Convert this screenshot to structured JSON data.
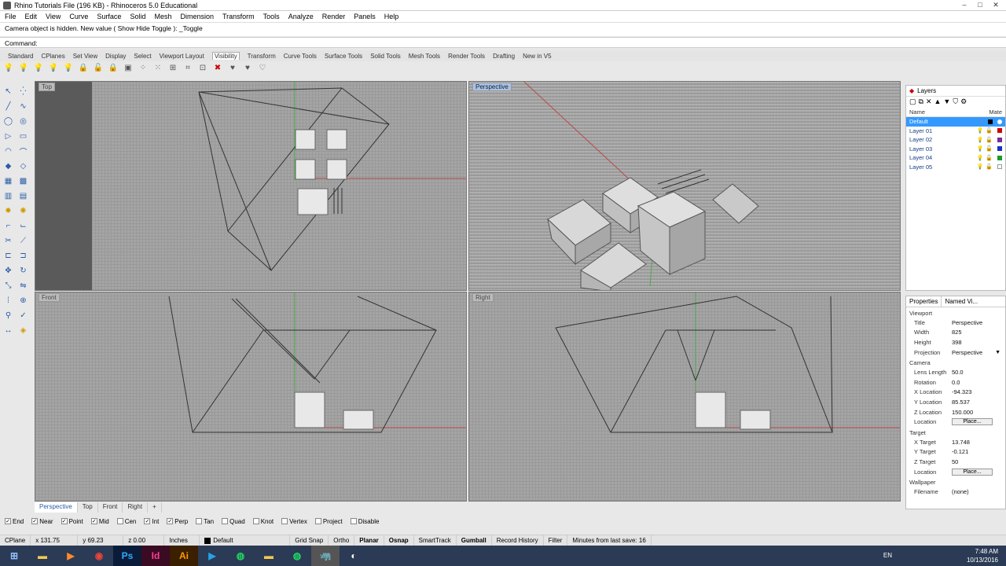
{
  "window": {
    "title": "Rhino Tutorials File (196 KB) - Rhinoceros 5.0 Educational",
    "controls": [
      "–",
      "□",
      "✕"
    ]
  },
  "menu": [
    "File",
    "Edit",
    "View",
    "Curve",
    "Surface",
    "Solid",
    "Mesh",
    "Dimension",
    "Transform",
    "Tools",
    "Analyze",
    "Render",
    "Panels",
    "Help"
  ],
  "command": {
    "history": "Camera object is hidden. New value ( Show  Hide  Toggle ): _Toggle",
    "prompt": "Command:"
  },
  "toolbar_tabs": [
    "Standard",
    "CPlanes",
    "Set View",
    "Display",
    "Select",
    "Viewport Layout",
    "Visibility",
    "Transform",
    "Curve Tools",
    "Surface Tools",
    "Solid Tools",
    "Mesh Tools",
    "Render Tools",
    "Drafting",
    "New in V5"
  ],
  "active_tab": "Visibility",
  "viewports": {
    "top": "Top",
    "perspective": "Perspective",
    "front": "Front",
    "right": "Right"
  },
  "viewport_tabs": [
    "Perspective",
    "Top",
    "Front",
    "Right",
    "+"
  ],
  "osnaps": [
    {
      "label": "End",
      "checked": true
    },
    {
      "label": "Near",
      "checked": true
    },
    {
      "label": "Point",
      "checked": true
    },
    {
      "label": "Mid",
      "checked": true
    },
    {
      "label": "Cen",
      "checked": false
    },
    {
      "label": "Int",
      "checked": true
    },
    {
      "label": "Perp",
      "checked": true
    },
    {
      "label": "Tan",
      "checked": false
    },
    {
      "label": "Quad",
      "checked": false
    },
    {
      "label": "Knot",
      "checked": false
    },
    {
      "label": "Vertex",
      "checked": false
    },
    {
      "label": "Project",
      "checked": false
    },
    {
      "label": "Disable",
      "checked": false
    }
  ],
  "status": {
    "cplane": "CPlane",
    "x": "x 131.75",
    "y": "y 69.23",
    "z": "z 0.00",
    "units": "Inches",
    "layer": "Default",
    "grid_snap": "Grid Snap",
    "ortho": "Ortho",
    "planar": "Planar",
    "osnap": "Osnap",
    "smarttrack": "SmartTrack",
    "gumball": "Gumball",
    "record_history": "Record History",
    "filter": "Filter",
    "last_save": "Minutes from last save: 16"
  },
  "layers": {
    "panel_title": "Layers",
    "col_name": "Name",
    "col_mat": "Mate",
    "items": [
      {
        "name": "Default",
        "color": "#000000",
        "selected": true
      },
      {
        "name": "Layer 01",
        "color": "#d40000",
        "selected": false
      },
      {
        "name": "Layer 02",
        "color": "#7a2a9a",
        "selected": false
      },
      {
        "name": "Layer 03",
        "color": "#1a2fd0",
        "selected": false
      },
      {
        "name": "Layer 04",
        "color": "#1a9a2a",
        "selected": false
      },
      {
        "name": "Layer 05",
        "color": "#ffffff",
        "selected": false
      }
    ]
  },
  "properties": {
    "tab_properties": "Properties",
    "tab_named": "Named Vi...",
    "viewport_section": "Viewport",
    "viewport": [
      [
        "Title",
        "Perspective"
      ],
      [
        "Width",
        "825"
      ],
      [
        "Height",
        "398"
      ],
      [
        "Projection",
        "Perspective"
      ]
    ],
    "camera_section": "Camera",
    "camera": [
      [
        "Lens Length",
        "50.0"
      ],
      [
        "Rotation",
        "0.0"
      ],
      [
        "X Location",
        "-94.323"
      ],
      [
        "Y Location",
        "85.537"
      ],
      [
        "Z Location",
        "150.000"
      ],
      [
        "Location",
        "Place..."
      ]
    ],
    "target_section": "Target",
    "target": [
      [
        "X Target",
        "13.748"
      ],
      [
        "Y Target",
        "-0.121"
      ],
      [
        "Z Target",
        "50"
      ],
      [
        "Location",
        "Place..."
      ]
    ],
    "wallpaper_section": "Wallpaper",
    "wallpaper": [
      [
        "Filename",
        "(none)"
      ]
    ]
  },
  "taskbar": {
    "lang": "EN",
    "time": "7:48 AM",
    "date": "10/13/2016",
    "apps": [
      "Ps",
      "Id",
      "Ai"
    ]
  }
}
